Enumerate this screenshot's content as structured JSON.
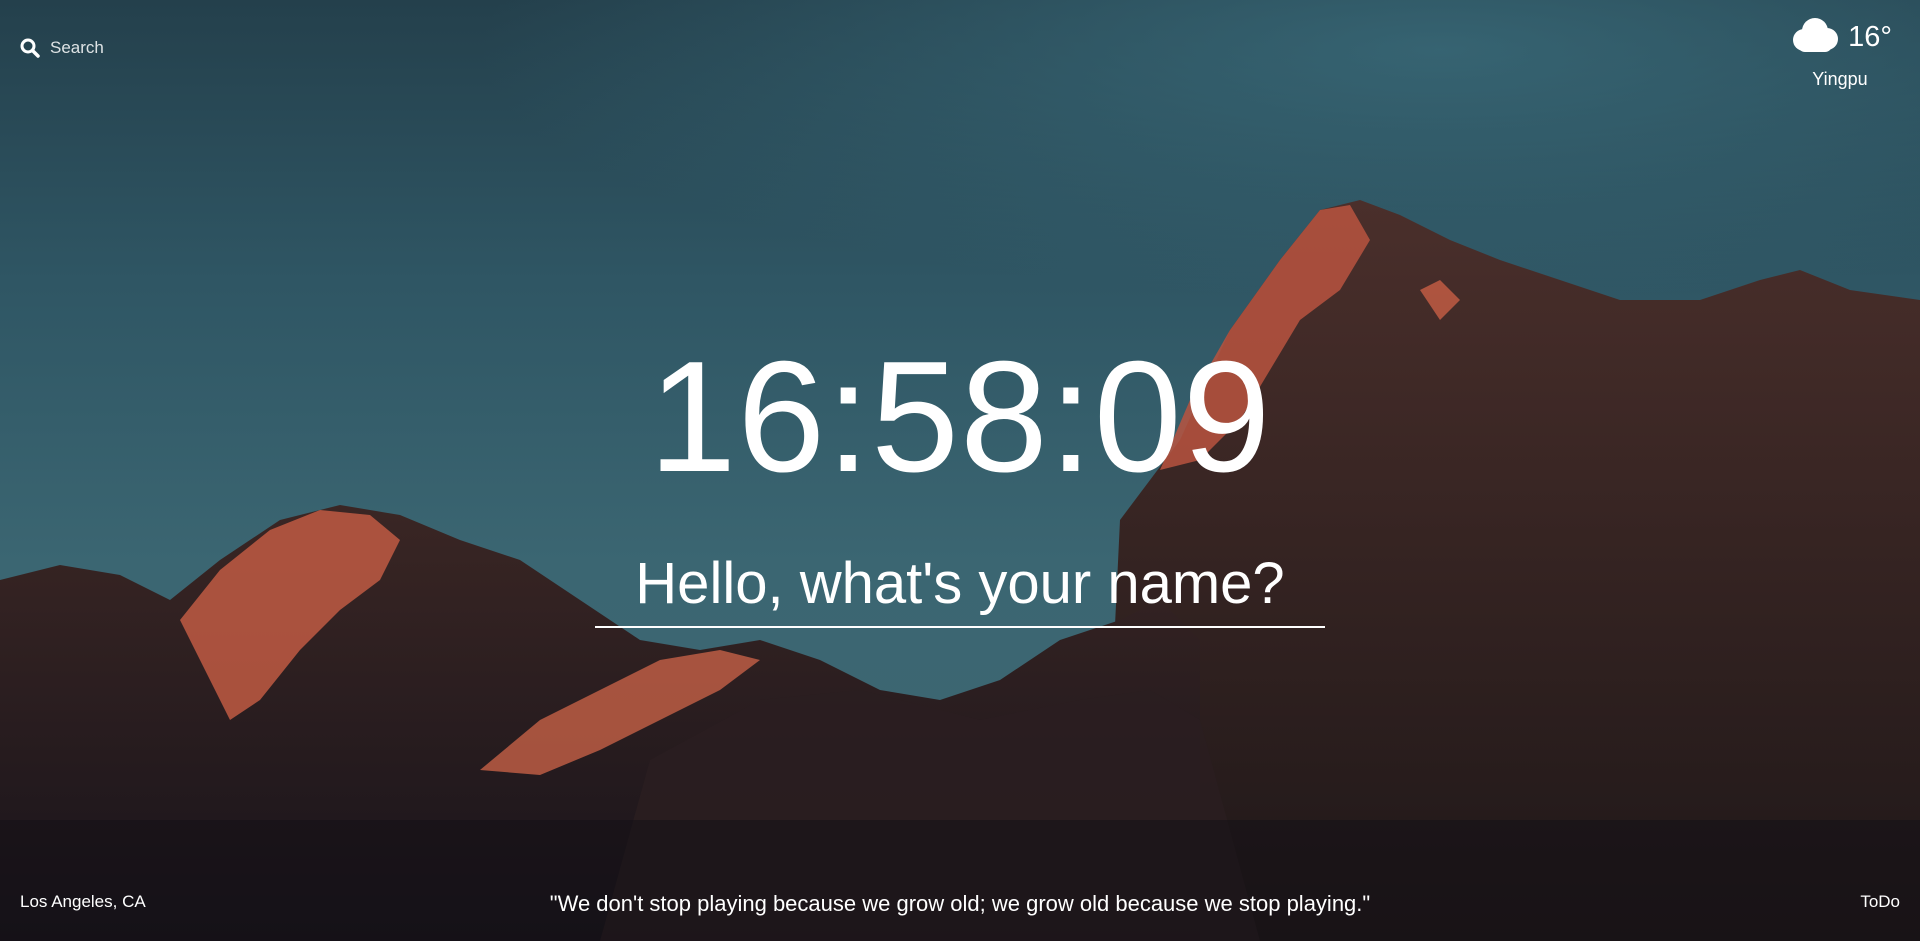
{
  "search": {
    "placeholder": "Search",
    "icon": "search-icon"
  },
  "weather": {
    "icon": "cloud-icon",
    "temperature": "16°",
    "location": "Yingpu"
  },
  "clock": {
    "time": "16:58:09"
  },
  "greeting": {
    "prompt": "Hello, what's your name?"
  },
  "footer": {
    "photo_location": "Los Angeles, CA",
    "quote": "\"We don't stop playing because we grow old; we grow old because we stop playing.\"",
    "todo_label": "ToDo"
  },
  "colors": {
    "sky": "#2f5866",
    "rock_lit": "#d8654a",
    "rock_dark": "#2a1f1f",
    "text": "#ffffff"
  }
}
